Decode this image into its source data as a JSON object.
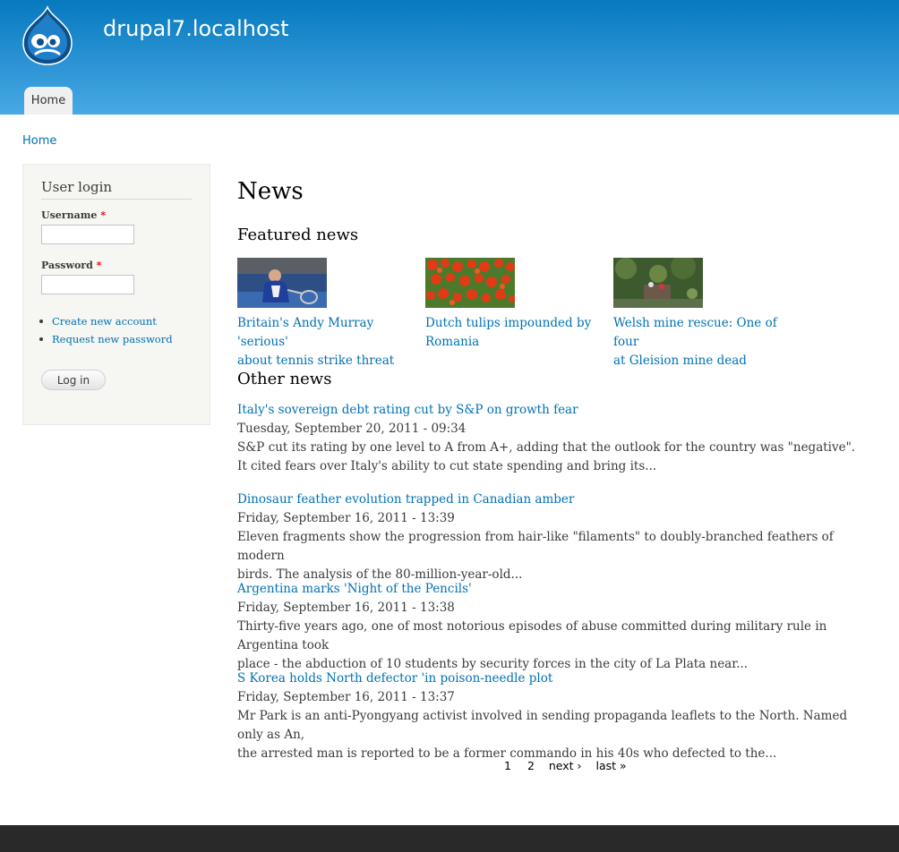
{
  "header": {
    "site_name": "drupal7.localhost",
    "nav": {
      "home_tab": "Home"
    }
  },
  "breadcrumb": "Home",
  "sidebar": {
    "login_title": "User login",
    "username_label": "Username",
    "password_label": "Password",
    "required_marker": "*",
    "links": [
      "Create new account",
      "Request new password"
    ],
    "login_button": "Log in"
  },
  "main": {
    "page_title": "News",
    "featured_heading": "Featured news",
    "featured": [
      {
        "title_line1": "Britain's Andy Murray 'serious'",
        "title_line2": "about tennis strike threat",
        "image": "tennis-player-photo"
      },
      {
        "title_line1": "Dutch tulips impounded by",
        "title_line2": "Romania",
        "image": "red-tulips-photo"
      },
      {
        "title_line1": "Welsh mine rescue: One of four",
        "title_line2": "at Gleision mine dead",
        "image": "mine-rescue-photo"
      }
    ],
    "other_heading": "Other news",
    "news": [
      {
        "title": "Italy's sovereign debt rating cut by S&P on growth fear",
        "date": "Tuesday, September 20, 2011 - 09:34",
        "body1": "S&P cut its rating by one level to A from A+, adding that the outlook for the country was \"negative\".",
        "body2": "It cited fears over Italy's ability to cut state spending and bring its..."
      },
      {
        "title": "Dinosaur feather evolution trapped in Canadian amber",
        "date": "Friday, September 16, 2011 - 13:39",
        "body1": "Eleven fragments show the progression from hair-like \"filaments\" to doubly-branched feathers of modern",
        "body2": "birds. The analysis of the 80-million-year-old..."
      },
      {
        "title": "Argentina marks 'Night of the Pencils'",
        "date": "Friday, September 16, 2011 - 13:38",
        "body1": "Thirty-five years ago, one of most notorious episodes of abuse committed during military rule in Argentina took",
        "body2": "place - the abduction of 10 students by security forces in the city of La Plata near..."
      },
      {
        "title": "S Korea holds North defector 'in poison-needle plot",
        "date": "Friday, September 16, 2011 - 13:37",
        "body1": "Mr Park is an anti-Pyongyang activist involved in sending propaganda leaflets to the North. Named only as An,",
        "body2": "the arrested man is reported to be a former commando in his 40s who defected to the..."
      }
    ],
    "pager": {
      "current": "1",
      "page2": "2",
      "next": "next ›",
      "last": "last »"
    }
  },
  "colors": {
    "header_top": "#0779bf",
    "header_bottom": "#48a9e4",
    "link": "#0071b3",
    "footer": "#292929"
  }
}
